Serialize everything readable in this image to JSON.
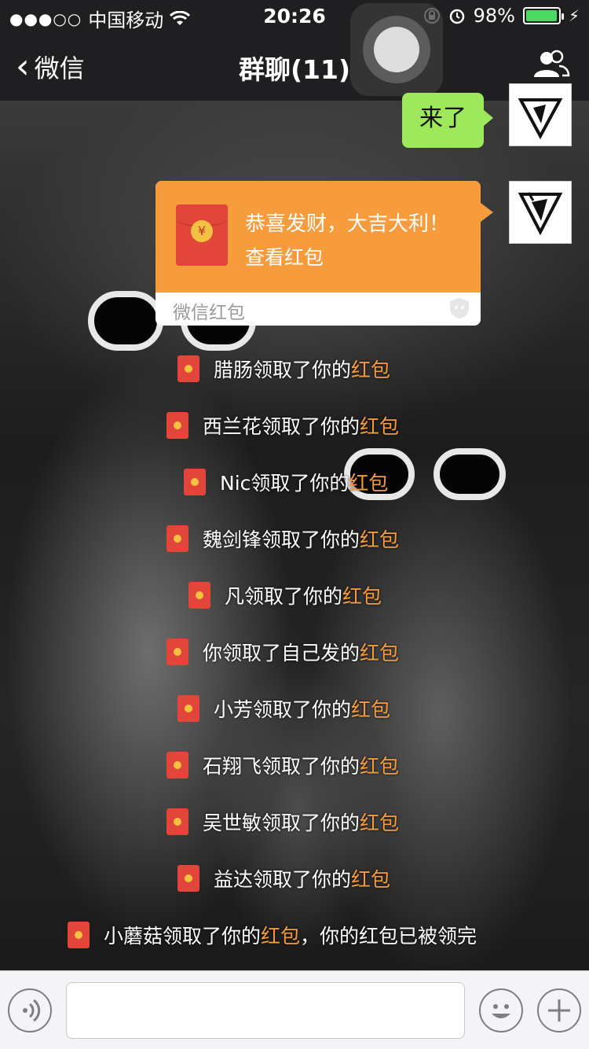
{
  "status_bar": {
    "signal": "●●●○○",
    "carrier": "中国移动",
    "time": "20:26",
    "battery": "98%",
    "battery_level": 0.98,
    "battery_color": "#4cd964"
  },
  "nav": {
    "back_label": "微信",
    "title": "群聊(11)",
    "people_icon": "group-people-icon"
  },
  "messages": {
    "sent_text": "来了",
    "red_packet": {
      "greeting": "恭喜发财，大吉大利！",
      "action": "查看红包",
      "footer": "微信红包",
      "coin": "¥"
    }
  },
  "notices": [
    {
      "prefix": "腊肠领取了你的",
      "highlight": "红包",
      "suffix": ""
    },
    {
      "prefix": "西兰花领取了你的",
      "highlight": "红包",
      "suffix": ""
    },
    {
      "prefix": "Nic领取了你的",
      "highlight": "红包",
      "suffix": ""
    },
    {
      "prefix": "魏剑锋领取了你的",
      "highlight": "红包",
      "suffix": ""
    },
    {
      "prefix": "凡领取了你的",
      "highlight": "红包",
      "suffix": ""
    },
    {
      "prefix": "你领取了自己发的",
      "highlight": "红包",
      "suffix": ""
    },
    {
      "prefix": "小芳领取了你的",
      "highlight": "红包",
      "suffix": ""
    },
    {
      "prefix": "石翔飞领取了你的",
      "highlight": "红包",
      "suffix": ""
    },
    {
      "prefix": "吴世敏领取了你的",
      "highlight": "红包",
      "suffix": ""
    },
    {
      "prefix": "益达领取了你的",
      "highlight": "红包",
      "suffix": ""
    },
    {
      "prefix": "小蘑菇领取了你的",
      "highlight": "红包",
      "suffix": "，你的红包已被领完"
    }
  ],
  "colors": {
    "accent_orange": "#f79c3c",
    "bubble_green": "#9ee85c",
    "red_packet_red": "#e2463a",
    "nav_bg": "#1f1f22"
  },
  "input_bar": {
    "voice_icon": "voice-icon",
    "emoji_icon": "emoji-icon",
    "add_icon": "plus-icon"
  }
}
